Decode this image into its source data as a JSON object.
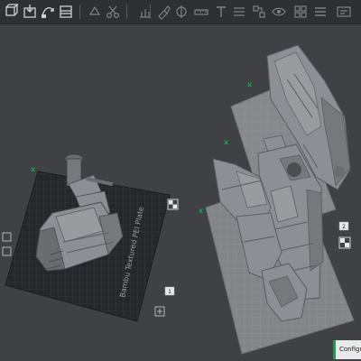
{
  "toolbar": {
    "icons": [
      "add-cube-icon",
      "import-box-icon",
      "auto-arrange-icon",
      "layout-icon",
      "orient-icon",
      "cut-icon",
      "support-icon",
      "paint-icon",
      "seam-icon",
      "measure-icon",
      "text-icon",
      "variable-layer-icon",
      "assembly-icon",
      "view-icon",
      "grid-icon",
      "list-icon",
      "settings-icon"
    ]
  },
  "plates": [
    {
      "label": "Bambu Textured PEI Plate",
      "number": "1",
      "color": "#26272b",
      "style": "dark-grid"
    },
    {
      "number": "2",
      "color": "#8a8b8f",
      "style": "light-grid"
    }
  ],
  "status": {
    "message": "Configurati",
    "accent": "#00ae42"
  },
  "colors": {
    "background": "#3f4145",
    "model": "#8e8f94",
    "model_shadow": "#5b5c60",
    "axis_green": "#00ae42"
  }
}
